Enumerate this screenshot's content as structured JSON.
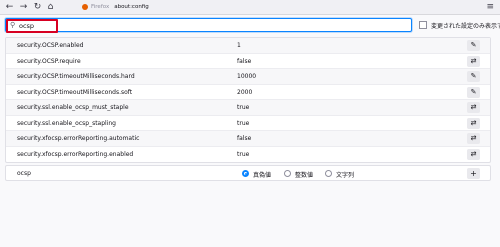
{
  "browser": {
    "name": "Firefox",
    "url": "about:config"
  },
  "search": {
    "query": "ocsp",
    "icon": "search-icon"
  },
  "modified_only_label": "変更された設定のみ表示する",
  "prefs": [
    {
      "name": "security.OCSP.enabled",
      "value": "1",
      "action": "edit"
    },
    {
      "name": "security.OCSP.require",
      "value": "false",
      "action": "toggle"
    },
    {
      "name": "security.OCSP.timeoutMilliseconds.hard",
      "value": "10000",
      "action": "edit"
    },
    {
      "name": "security.OCSP.timeoutMilliseconds.soft",
      "value": "2000",
      "action": "edit"
    },
    {
      "name": "security.ssl.enable_ocsp_must_staple",
      "value": "true",
      "action": "toggle"
    },
    {
      "name": "security.ssl.enable_ocsp_stapling",
      "value": "true",
      "action": "toggle"
    },
    {
      "name": "security.xfocsp.errorReporting.automatic",
      "value": "false",
      "action": "toggle"
    },
    {
      "name": "security.xfocsp.errorReporting.enabled",
      "value": "true",
      "action": "toggle"
    }
  ],
  "new_pref": {
    "name": "ocsp",
    "types": [
      {
        "label": "真偽値",
        "selected": true
      },
      {
        "label": "整数値",
        "selected": false
      },
      {
        "label": "文字列",
        "selected": false
      }
    ]
  },
  "colors": {
    "accent": "#0a84ff",
    "highlight": "#d70022"
  }
}
